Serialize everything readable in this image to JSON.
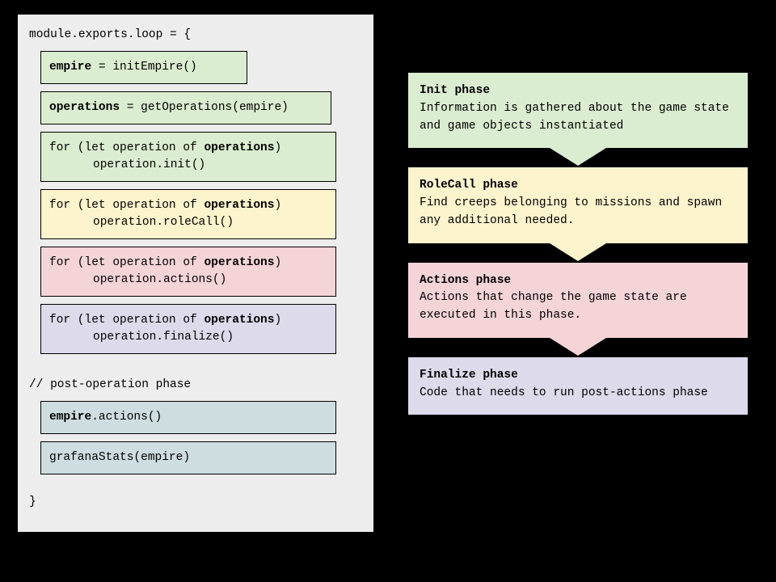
{
  "code": {
    "header": "module.exports.loop = {",
    "boxes": [
      {
        "html": "<b>empire</b> = initEmpire()",
        "cls": "c-green narrow"
      },
      {
        "html": "<b>operations</b> = getOperations(empire)",
        "cls": "c-green mid"
      },
      {
        "html": "for (let operation of <b>operations</b>)<span class=\"indent\">operation.init()</span>",
        "cls": "c-green wide"
      },
      {
        "html": "for (let operation of <b>operations</b>)<span class=\"indent\">operation.roleCall()</span>",
        "cls": "c-yellow wide"
      },
      {
        "html": "for (let operation of <b>operations</b>)<span class=\"indent\">operation.actions()</span>",
        "cls": "c-pink wide"
      },
      {
        "html": "for (let operation of <b>operations</b>)<span class=\"indent\">operation.finalize()</span>",
        "cls": "c-purple wide"
      }
    ],
    "comment": "// post-operation phase",
    "postBoxes": [
      {
        "html": "<b>empire</b>.actions()",
        "cls": "c-blue wide"
      },
      {
        "html": "grafanaStats(empire)",
        "cls": "c-blue wide"
      }
    ],
    "footer": "}"
  },
  "phases": [
    {
      "title": "Init phase",
      "desc": "Information is gathered about the game state and game objects instantiated",
      "cls": "c-green"
    },
    {
      "title": "RoleCall phase",
      "desc": "Find creeps belonging to missions and spawn any additional needed.",
      "cls": "c-yellow"
    },
    {
      "title": "Actions phase",
      "desc": "Actions that change the game state are executed in this phase.",
      "cls": "c-pink"
    },
    {
      "title": "Finalize phase",
      "desc": "Code that needs to run post-actions phase",
      "cls": "c-purple"
    }
  ],
  "chevrons": [
    "chev-green",
    "chev-yellow",
    "chev-pink"
  ]
}
